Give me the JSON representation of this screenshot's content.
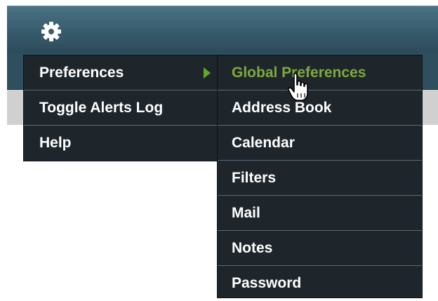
{
  "toolbar": {
    "settings_icon": "gear-icon"
  },
  "main_menu": {
    "items": [
      "Preferences",
      "Toggle Alerts Log",
      "Help"
    ],
    "submenu_arrow_icon": "triangle-right-icon"
  },
  "preferences_submenu": {
    "items": [
      "Global Preferences",
      "Address Book",
      "Calendar",
      "Filters",
      "Mail",
      "Notes",
      "Password"
    ],
    "highlighted_index": 0
  },
  "colors": {
    "header": "#3a5f70",
    "menu_background": "#1e262c",
    "highlight_text": "#7ea93c",
    "arrow": "#5fa82a"
  },
  "cursor_icon": "hand-pointer-icon"
}
